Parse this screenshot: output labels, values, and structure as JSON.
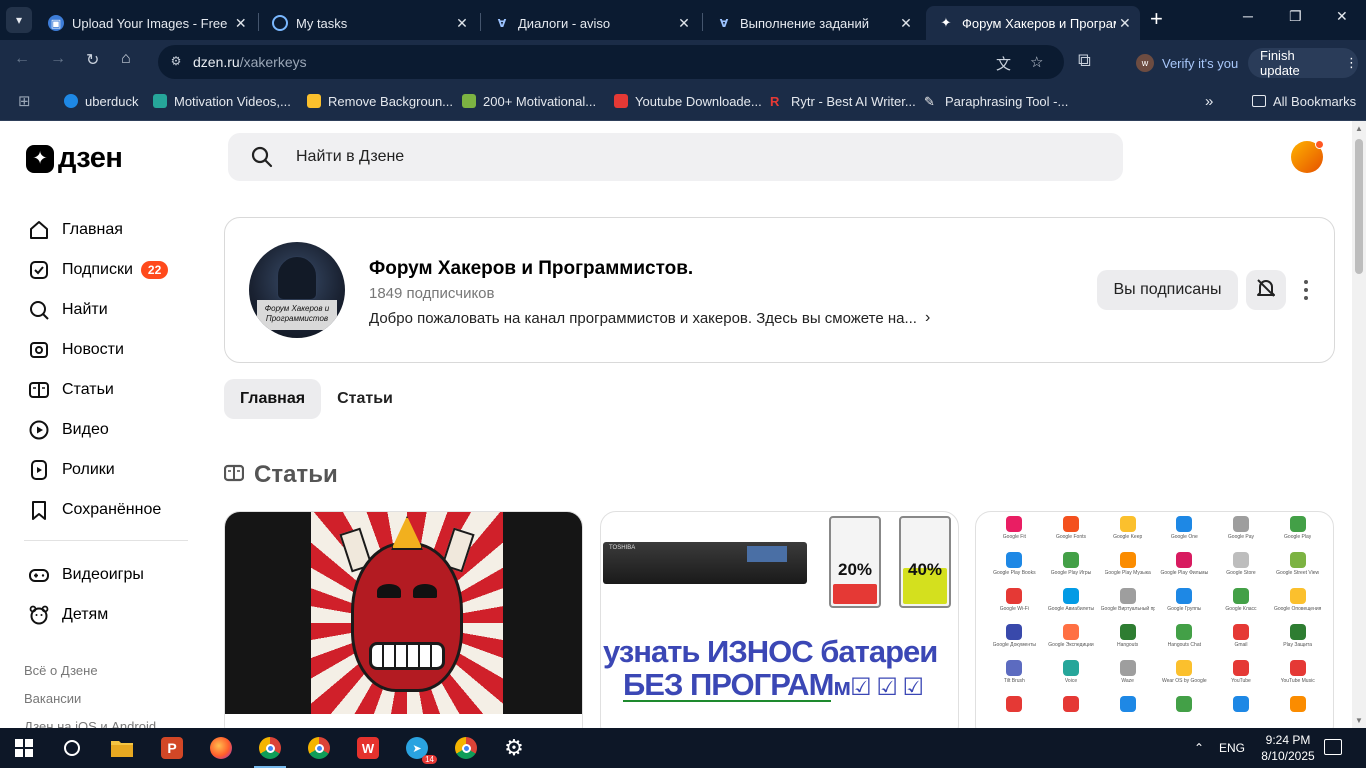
{
  "browser": {
    "tabs": [
      {
        "title": "Upload Your Images - Free Im",
        "active": false
      },
      {
        "title": "My tasks",
        "active": false
      },
      {
        "title": "Диалоги - aviso",
        "active": false
      },
      {
        "title": "Выполнение заданий",
        "active": false
      },
      {
        "title": "Форум Хакеров и Программ",
        "active": true
      }
    ],
    "url_host": "dzen.ru",
    "url_path": "/xakerkeys",
    "verify_label": "Verify it's you",
    "finish_update_label": "Finish update",
    "bookmarks": [
      {
        "label": "uberduck",
        "color": "#1e88e5"
      },
      {
        "label": "Motivation Videos,...",
        "color": "#26a69a"
      },
      {
        "label": "Remove Backgroun...",
        "color": "#fbc02d"
      },
      {
        "label": "200+ Motivational...",
        "color": "#7cb342"
      },
      {
        "label": "Youtube Downloade...",
        "color": "#e53935"
      },
      {
        "label": "Rytr - Best AI Writer...",
        "color": "#e53935"
      },
      {
        "label": "Paraphrasing Tool -...",
        "color": "#eeeeee"
      }
    ],
    "all_bookmarks_label": "All Bookmarks"
  },
  "dzen": {
    "logo_text": "дзен",
    "search_placeholder": "Найти в Дзене",
    "nav": [
      {
        "label": "Главная",
        "icon": "home-icon"
      },
      {
        "label": "Подписки",
        "icon": "subscriptions-icon",
        "badge": "22"
      },
      {
        "label": "Найти",
        "icon": "search-icon"
      },
      {
        "label": "Новости",
        "icon": "news-icon"
      },
      {
        "label": "Статьи",
        "icon": "articles-icon"
      },
      {
        "label": "Видео",
        "icon": "video-icon"
      },
      {
        "label": "Ролики",
        "icon": "shorts-icon"
      },
      {
        "label": "Сохранённое",
        "icon": "bookmark-icon"
      },
      {
        "label": "Видеоигры",
        "icon": "gamepad-icon"
      },
      {
        "label": "Детям",
        "icon": "kids-icon"
      }
    ],
    "footer_links": [
      "Всё о Дзене",
      "Вакансии",
      "Дзен на iOS и Android"
    ],
    "channel": {
      "name": "Форум Хакеров и Программистов.",
      "subscribers": "1849 подписчиков",
      "description": "Добро пожаловать на канал программистов и хакеров. Здесь вы сможете на...",
      "avatar_caption": "Форум Хакеров и Программистов",
      "subscribed_label": "Вы подписаны"
    },
    "page_tabs": [
      {
        "label": "Главная",
        "active": true
      },
      {
        "label": "Статьи",
        "active": false
      }
    ],
    "section_title": "Статьи",
    "cards": {
      "battery_pct_red": "20%",
      "battery_pct_yellow": "40%",
      "battery_label": "TOSHIBA",
      "battery_text_1": "узнать ИЗНОС батареи",
      "battery_text_2": "БЕЗ ПРОГРАМ",
      "battery_text_tail": "м☑ ☑ ☑",
      "apps": [
        {
          "label": "Google Fit",
          "color": "#e91e63"
        },
        {
          "label": "Google Fonts",
          "color": "#f4511e"
        },
        {
          "label": "Google Keep",
          "color": "#fbc02d"
        },
        {
          "label": "Google One",
          "color": "#1e88e5"
        },
        {
          "label": "Google Pay",
          "color": "#9e9e9e"
        },
        {
          "label": "Google Play",
          "color": "#43a047"
        },
        {
          "label": "Google Play Books",
          "color": "#1e88e5"
        },
        {
          "label": "Google Play Игры",
          "color": "#43a047"
        },
        {
          "label": "Google Play Музыка",
          "color": "#fb8c00"
        },
        {
          "label": "Google Play Фильмы",
          "color": "#d81b60"
        },
        {
          "label": "Google Store",
          "color": "#bdbdbd"
        },
        {
          "label": "Google Street View",
          "color": "#7cb342"
        },
        {
          "label": "Google Wi-Fi",
          "color": "#e53935"
        },
        {
          "label": "Google Авиабилеты",
          "color": "#039be5"
        },
        {
          "label": "Google Виртуальный принтер",
          "color": "#9e9e9e"
        },
        {
          "label": "Google Группы",
          "color": "#1e88e5"
        },
        {
          "label": "Google Класс",
          "color": "#43a047"
        },
        {
          "label": "Google Оповещения",
          "color": "#fbc02d"
        },
        {
          "label": "Google Документы",
          "color": "#3949ab"
        },
        {
          "label": "Google Экспедиции",
          "color": "#ff7043"
        },
        {
          "label": "Hangouts",
          "color": "#2e7d32"
        },
        {
          "label": "Hangouts Chat",
          "color": "#43a047"
        },
        {
          "label": "Gmail",
          "color": "#e53935"
        },
        {
          "label": "Play Защита",
          "color": "#2e7d32"
        },
        {
          "label": "Tilt Brush",
          "color": "#5c6bc0"
        },
        {
          "label": "Voice",
          "color": "#26a69a"
        },
        {
          "label": "Waze",
          "color": "#9e9e9e"
        },
        {
          "label": "Wear OS by Google",
          "color": "#fbc02d"
        },
        {
          "label": "YouTube",
          "color": "#e53935"
        },
        {
          "label": "YouTube Music",
          "color": "#e53935"
        },
        {
          "label": "",
          "color": "#e53935"
        },
        {
          "label": "",
          "color": "#e53935"
        },
        {
          "label": "",
          "color": "#1e88e5"
        },
        {
          "label": "",
          "color": "#43a047"
        },
        {
          "label": "",
          "color": "#1e88e5"
        },
        {
          "label": "",
          "color": "#fb8c00"
        }
      ]
    }
  },
  "taskbar": {
    "telegram_badge": "14",
    "language": "ENG",
    "time": "9:24 PM",
    "date": "8/10/2025"
  },
  "colors": {
    "accent": "#ff4a1c",
    "chrome_dark": "#0b1b31",
    "chrome": "#1b2c47"
  }
}
